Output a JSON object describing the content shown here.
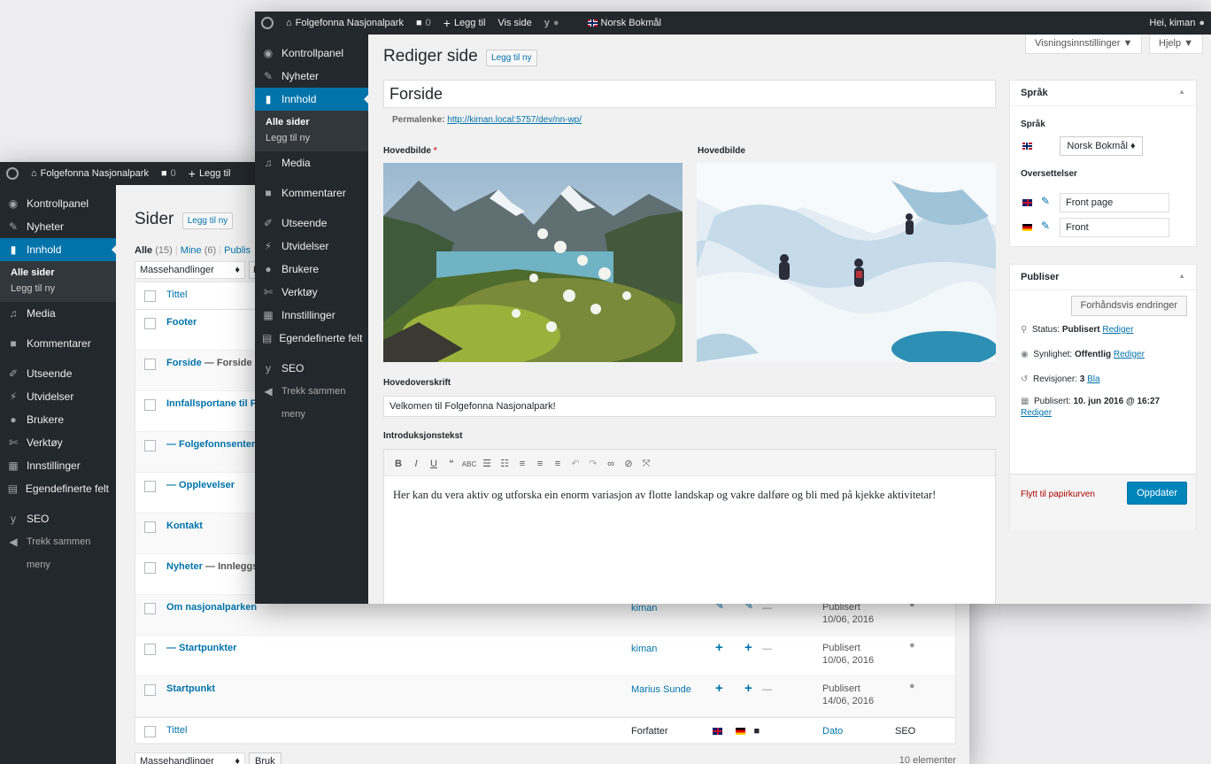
{
  "back": {
    "adminbar": {
      "site": "Folgefonna Nasjonalpark",
      "comments": "0",
      "new": "Legg til"
    },
    "menu": {
      "kontroll": "Kontrollpanel",
      "nyheter": "Nyheter",
      "innhold": "Innhold",
      "alle": "Alle sider",
      "legg": "Legg til ny",
      "media": "Media",
      "komm": "Kommentarer",
      "utseende": "Utseende",
      "utvid": "Utvidelser",
      "brukere": "Brukere",
      "verktoy": "Verktøy",
      "innst": "Innstillinger",
      "egen": "Egendefinerte felt",
      "seo": "SEO",
      "trekk": "Trekk sammen",
      "meny": "meny"
    },
    "title": "Sider",
    "add_new": "Legg til ny",
    "filters": {
      "all": "Alle",
      "all_count": "(15)",
      "sep": "|",
      "mine": "Mine",
      "mine_count": "(6)",
      "pub": "Publis"
    },
    "bulk": "Massehandlinger",
    "apply_partial": "B",
    "col_title": "Tittel",
    "rows": [
      {
        "title": "Footer",
        "suffix": ""
      },
      {
        "title": "Forside",
        "suffix": " — Forside"
      },
      {
        "title": "Innfallsportane til F",
        "suffix": ""
      },
      {
        "title": "— Folgefonnsenter",
        "suffix": ""
      },
      {
        "title": "— Opplevelser",
        "suffix": ""
      },
      {
        "title": "Kontakt",
        "suffix": ""
      },
      {
        "title": "Nyheter",
        "suffix": " — Innleggs"
      },
      {
        "title": "Om nasjonalparken",
        "suffix": "",
        "author": "kiman",
        "status": "Publisert",
        "date": "10/06, 2016",
        "trans": "edit"
      },
      {
        "title": "— Startpunkter",
        "suffix": "",
        "author": "kiman",
        "status": "Publisert",
        "date": "10/06, 2016",
        "trans": "add"
      },
      {
        "title": "Startpunkt",
        "suffix": "",
        "author": "Marius Sunde",
        "status": "Publisert",
        "date": "14/06, 2016",
        "trans": "add"
      }
    ],
    "footer": {
      "title": "Tittel",
      "author": "Forfatter",
      "date": "Dato",
      "seo": "SEO"
    },
    "bulk_bottom": "Massehandlinger",
    "apply": "Bruk",
    "count": "10 elementer",
    "dash": "—"
  },
  "front": {
    "adminbar": {
      "site": "Folgefonna Nasjonalpark",
      "comments": "0",
      "new": "Legg til",
      "view": "Vis side",
      "lang": "Norsk Bokmål",
      "greet": "Hei, kiman"
    },
    "screen_options": "Visningsinnstillinger ▼",
    "help": "Hjelp ▼",
    "menu": {
      "kontroll": "Kontrollpanel",
      "nyheter": "Nyheter",
      "innhold": "Innhold",
      "alle": "Alle sider",
      "legg": "Legg til ny",
      "media": "Media",
      "komm": "Kommentarer",
      "utseende": "Utseende",
      "utvid": "Utvidelser",
      "brukere": "Brukere",
      "verktoy": "Verktøy",
      "innst": "Innstillinger",
      "egen": "Egendefinerte felt",
      "seo": "SEO",
      "trekk": "Trekk sammen",
      "meny": "meny"
    },
    "heading": "Rediger side",
    "add_new": "Legg til ny",
    "post_title": "Forside",
    "permalink_label": "Permalenke:",
    "permalink": "http://kiman.local:5757/dev/nn-wp/",
    "img1_label": "Hovedbilde",
    "req": "*",
    "img2_label": "Hovedbilde",
    "headline_label": "Hovedoverskrift",
    "headline": "Velkomen til Folgefonna Nasjonalpark!",
    "intro_label": "Introduksjonstekst",
    "intro": "Her kan du vera aktiv og utforska ein enorm variasjon av flotte landskap og vakre dalføre og bli med på kjekke aktivitetar!",
    "lang_box": {
      "title": "Språk",
      "label": "Språk",
      "select": "Norsk Bokmål ♦",
      "trans_label": "Oversettelser",
      "en": "Front page",
      "de": "Front"
    },
    "pub_box": {
      "title": "Publiser",
      "preview": "Forhåndsvis endringer",
      "status_l": "Status:",
      "status_v": "Publisert",
      "vis_l": "Synlighet:",
      "vis_v": "Offentlig",
      "rev_l": "Revisjoner:",
      "rev_v": "3",
      "browse": "Bla",
      "pubd_l": "Publisert:",
      "pubd_v": "10. jun 2016 @ 16:27",
      "edit": "Rediger",
      "trash": "Flytt til papirkurven",
      "update": "Oppdater"
    }
  },
  "colors": {
    "blue": "#0073aa",
    "dark": "#23282d",
    "red": "#dc3232"
  }
}
